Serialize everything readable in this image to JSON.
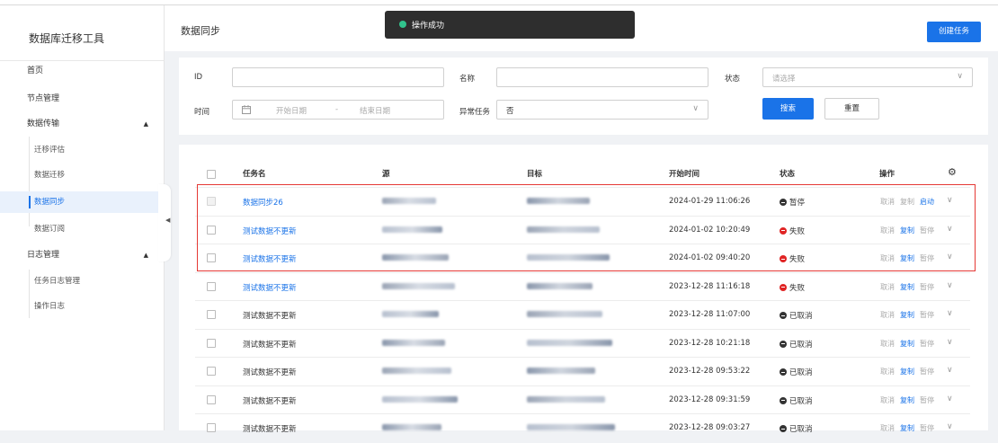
{
  "app": {
    "title": "数据库迁移工具"
  },
  "sidebar": {
    "items": [
      {
        "label": "首页"
      },
      {
        "label": "节点管理"
      },
      {
        "label": "数据传输",
        "caret": "▲"
      },
      {
        "label": "日志管理",
        "caret": "▲"
      }
    ],
    "transfer_children": [
      {
        "label": "迁移评估"
      },
      {
        "label": "数据迁移"
      },
      {
        "label": "数据同步"
      },
      {
        "label": "数据订阅"
      }
    ],
    "log_children": [
      {
        "label": "任务日志管理"
      },
      {
        "label": "操作日志"
      }
    ],
    "collapse_icon": "◀"
  },
  "header": {
    "title": "数据同步",
    "create_button": "创建任务"
  },
  "toast": {
    "message": "操作成功",
    "color": "#31c48d"
  },
  "filters": {
    "id_label": "ID",
    "name_label": "名称",
    "status_label": "状态",
    "status_placeholder": "请选择",
    "time_label": "时间",
    "start_placeholder": "开始日期",
    "range_sep": "-",
    "end_placeholder": "结束日期",
    "abnormal_label": "异常任务",
    "abnormal_value": "否",
    "search_button": "搜索",
    "reset_button": "重置",
    "chevron": "∨",
    "calendar_icon": "calendar-icon"
  },
  "table": {
    "columns": {
      "name": "任务名",
      "source": "源",
      "target": "目标",
      "start_time": "开始时间",
      "status": "状态",
      "actions": "操作"
    },
    "settings_icon": "⚙",
    "rows": [
      {
        "name": "数据同步26",
        "name_link": true,
        "start_time": "2024-01-29 11:06:26",
        "status": "暂停",
        "status_type": "pause",
        "a1": "取消",
        "a2": "复制",
        "a3": "启动",
        "a2_blue": false,
        "a3_blue": true,
        "disabled": true
      },
      {
        "name": "测试数据不更新",
        "name_link": true,
        "start_time": "2024-01-02 10:20:49",
        "status": "失败",
        "status_type": "fail",
        "a1": "取消",
        "a2": "复制",
        "a3": "暂停",
        "a2_blue": true,
        "a3_blue": false,
        "disabled": false
      },
      {
        "name": "测试数据不更新",
        "name_link": true,
        "start_time": "2024-01-02 09:40:20",
        "status": "失败",
        "status_type": "fail",
        "a1": "取消",
        "a2": "复制",
        "a3": "暂停",
        "a2_blue": true,
        "a3_blue": false,
        "disabled": false
      },
      {
        "name": "测试数据不更新",
        "name_link": true,
        "start_time": "2023-12-28 11:16:18",
        "status": "失败",
        "status_type": "fail",
        "a1": "取消",
        "a2": "复制",
        "a3": "暂停",
        "a2_blue": true,
        "a3_blue": false,
        "disabled": false
      },
      {
        "name": "测试数据不更新",
        "name_link": false,
        "start_time": "2023-12-28 11:07:00",
        "status": "已取消",
        "status_type": "cancel",
        "a1": "取消",
        "a2": "复制",
        "a3": "暂停",
        "a2_blue": true,
        "a3_blue": false,
        "disabled": false
      },
      {
        "name": "测试数据不更新",
        "name_link": false,
        "start_time": "2023-12-28 10:21:18",
        "status": "已取消",
        "status_type": "cancel",
        "a1": "取消",
        "a2": "复制",
        "a3": "暂停",
        "a2_blue": true,
        "a3_blue": false,
        "disabled": false
      },
      {
        "name": "测试数据不更新",
        "name_link": false,
        "start_time": "2023-12-28 09:53:22",
        "status": "已取消",
        "status_type": "cancel",
        "a1": "取消",
        "a2": "复制",
        "a3": "暂停",
        "a2_blue": true,
        "a3_blue": false,
        "disabled": false
      },
      {
        "name": "测试数据不更新",
        "name_link": false,
        "start_time": "2023-12-28 09:31:59",
        "status": "已取消",
        "status_type": "cancel",
        "a1": "取消",
        "a2": "复制",
        "a3": "暂停",
        "a2_blue": true,
        "a3_blue": false,
        "disabled": false
      },
      {
        "name": "测试数据不更新",
        "name_link": false,
        "start_time": "2023-12-28 09:03:27",
        "status": "已取消",
        "status_type": "cancel",
        "a1": "取消",
        "a2": "复制",
        "a3": "暂停",
        "a2_blue": true,
        "a3_blue": false,
        "disabled": false
      }
    ]
  },
  "colors": {
    "accent": "#1a73e8",
    "fail": "#e02424",
    "highlight": "#e53935"
  }
}
